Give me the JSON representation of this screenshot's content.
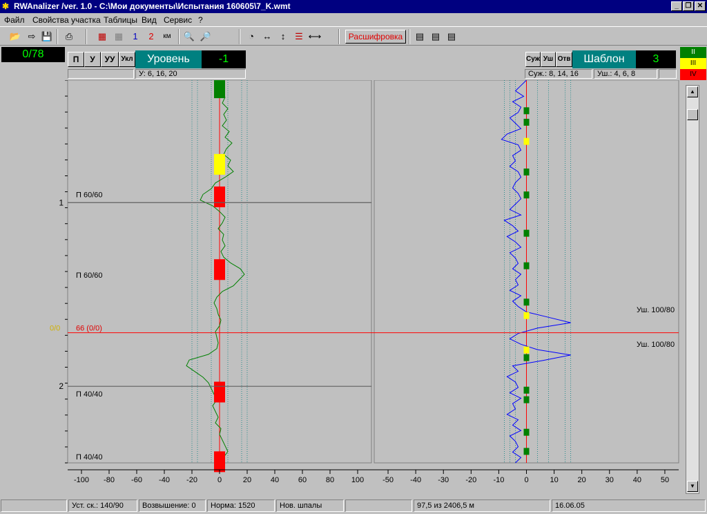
{
  "window": {
    "title": "RWAnalizer /ver. 1.0 - C:\\Мои документы\\Испытания 160605\\7_K.wmt"
  },
  "menu": [
    "Файл",
    "Свойства участка",
    "Таблицы",
    "Вид",
    "Сервис",
    "?"
  ],
  "toolbar": {
    "decode_label": "Расшифровка",
    "line1_label": "1",
    "line2_label": "2",
    "km_label": "км"
  },
  "counter": "0/78",
  "left_panel": {
    "buttons": [
      "П",
      "У",
      "УУ",
      "Укл"
    ],
    "title": "Уровень",
    "value": "-1",
    "thresholds": "У: 6, 16, 20"
  },
  "right_panel": {
    "buttons": [
      "Суж",
      "Уш",
      "Отв"
    ],
    "title": "Шаблон",
    "value": "3",
    "narrow_thresholds": "Суж.: 8, 14, 16",
    "wide_thresholds": "Уш.: 4, 6, 8"
  },
  "levels": [
    "II",
    "III",
    "IV"
  ],
  "colors": {
    "level_green": "#008000",
    "level_yellow": "#ffff00",
    "level_red": "#ff0000",
    "trace_left": "#008000",
    "trace_right": "#0000ff",
    "axis_red": "#ff0000"
  },
  "chart_data": [
    {
      "type": "line",
      "name": "Уровень",
      "xlim": [
        -110,
        110
      ],
      "x_ticks": [
        -100,
        -80,
        -60,
        -40,
        -20,
        0,
        20,
        40,
        60,
        80,
        100
      ],
      "km_marks": [
        {
          "label": "1",
          "pos": 0.32
        },
        {
          "label": "2",
          "pos": 0.8
        }
      ],
      "annotations": [
        {
          "label": "П 60/60",
          "pos": 0.31
        },
        {
          "label": "П 60/60",
          "pos": 0.52
        },
        {
          "label": "П 40/40",
          "pos": 0.83
        },
        {
          "label": "П 40/40",
          "pos": 0.995
        }
      ],
      "current_marker": {
        "left": "0/0",
        "label": "66 (0/0)",
        "pos": 0.66
      },
      "deviation_boxes": [
        {
          "level": "II",
          "pos": 0.02
        },
        {
          "level": "III",
          "pos": 0.22
        },
        {
          "level": "IV",
          "pos": 0.305
        },
        {
          "level": "IV",
          "pos": 0.495
        },
        {
          "level": "IV",
          "pos": 0.815
        },
        {
          "level": "IV",
          "pos": 0.997
        }
      ],
      "series": [
        {
          "values": [
            2,
            3,
            1,
            4,
            2,
            6,
            3,
            5,
            2,
            7,
            4,
            9,
            5,
            3,
            8,
            6,
            10,
            4,
            -3,
            -6,
            -12,
            -14,
            -5,
            0,
            4,
            2,
            -1,
            3,
            2,
            4,
            1,
            3,
            8,
            15,
            18,
            14,
            10,
            2,
            -2,
            -4,
            -2,
            -1,
            1,
            0,
            -3,
            -2,
            -1,
            -2,
            -8,
            -22,
            -24,
            -18,
            -12,
            -8,
            -6,
            -4,
            -2,
            -5,
            -3,
            -1,
            -3,
            1,
            0,
            2,
            4,
            6,
            3,
            2
          ]
        }
      ]
    },
    {
      "type": "line",
      "name": "Шаблон",
      "xlim": [
        -55,
        55
      ],
      "x_ticks": [
        -50,
        -40,
        -30,
        -20,
        -10,
        0,
        10,
        20,
        30,
        40,
        50
      ],
      "annotations": [
        {
          "label": "Уш. 100/80",
          "pos": 0.61
        },
        {
          "label": "Уш. 100/80",
          "pos": 0.7
        }
      ],
      "deviation_boxes": [
        {
          "level": "II",
          "pos": 0.08
        },
        {
          "level": "II",
          "pos": 0.11
        },
        {
          "level": "III",
          "pos": 0.16
        },
        {
          "level": "II",
          "pos": 0.24
        },
        {
          "level": "II",
          "pos": 0.3
        },
        {
          "level": "II",
          "pos": 0.4
        },
        {
          "level": "II",
          "pos": 0.485
        },
        {
          "level": "II",
          "pos": 0.58
        },
        {
          "level": "III",
          "pos": 0.615
        },
        {
          "level": "III",
          "pos": 0.705
        },
        {
          "level": "II",
          "pos": 0.725
        },
        {
          "level": "II",
          "pos": 0.81
        },
        {
          "level": "II",
          "pos": 0.835
        },
        {
          "level": "II",
          "pos": 0.92
        },
        {
          "level": "II",
          "pos": 0.97
        }
      ],
      "series": [
        {
          "values": [
            0,
            -2,
            -4,
            -1,
            -5,
            -2,
            -3,
            -6,
            -4,
            -2,
            -7,
            -9,
            -3,
            -2,
            -5,
            -4,
            -6,
            -3,
            -2,
            -4,
            -5,
            -3,
            -2,
            -4,
            -6,
            -2,
            -8,
            -5,
            -3,
            -7,
            -4,
            -2,
            -6,
            -4,
            -3,
            -5,
            -2,
            -4,
            -3,
            -6,
            -2,
            -5,
            -3,
            0,
            8,
            16,
            4,
            -3,
            -6,
            -2,
            4,
            16,
            6,
            -5,
            -3,
            -7,
            -4,
            -3,
            -6,
            -2,
            -5,
            -4,
            -7,
            -3,
            -5,
            -2,
            -6,
            -4,
            -3,
            -5,
            -2,
            -4
          ]
        }
      ]
    }
  ],
  "status": [
    "Уст. ск.: 140/90",
    "Возвышение: 0",
    "Норма: 1520",
    "Нов. шпалы",
    "",
    "97,5 из 2406,5 м",
    "16.06.05"
  ]
}
